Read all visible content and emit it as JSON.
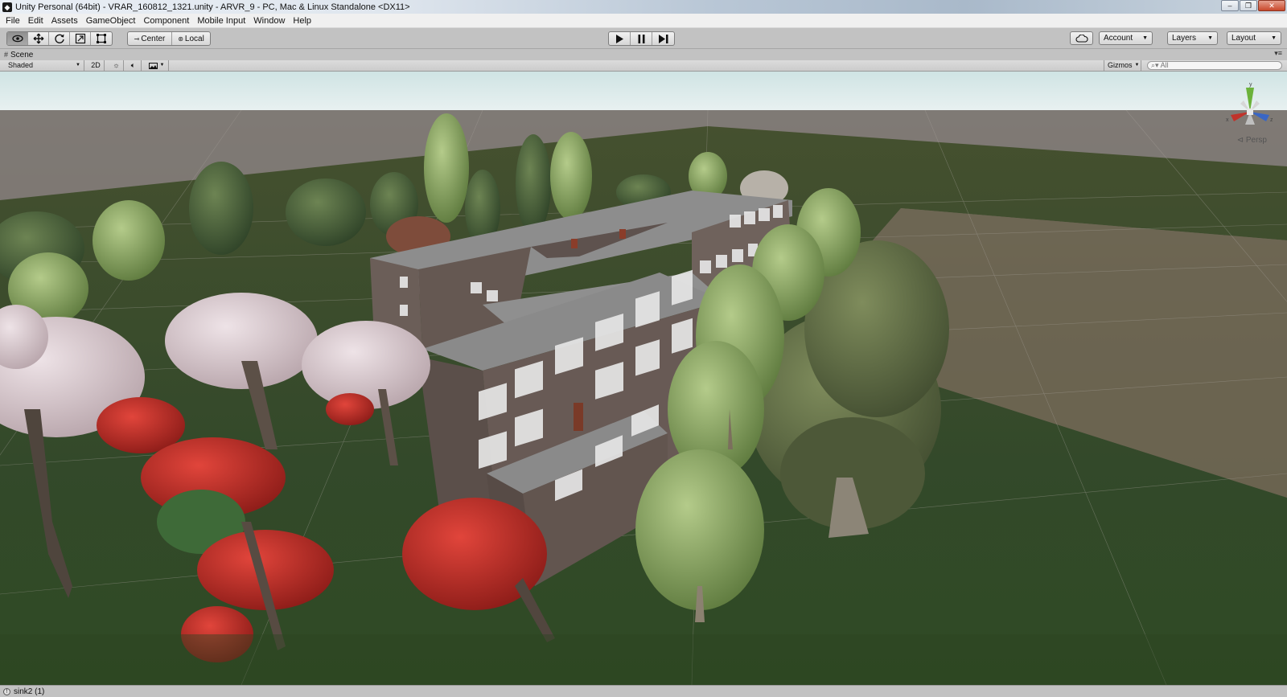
{
  "window": {
    "title": "Unity Personal (64bit) - VRAR_160812_1321.unity - ARVR_9 - PC, Mac & Linux Standalone <DX11>"
  },
  "menubar": {
    "items": [
      "File",
      "Edit",
      "Assets",
      "GameObject",
      "Component",
      "Mobile Input",
      "Window",
      "Help"
    ]
  },
  "toolbar": {
    "pivot_label": "Center",
    "space_label": "Local",
    "account_label": "Account",
    "layers_label": "Layers",
    "layout_label": "Layout"
  },
  "scene": {
    "tab_label": "Scene",
    "shading_mode": "Shaded",
    "mode_2d_label": "2D",
    "gizmos_label": "Gizmos",
    "search_placeholder": "All",
    "projection_label": "Persp"
  },
  "gizmo_axes": {
    "x": "x",
    "z": "z",
    "y": "y"
  },
  "status": {
    "message": "sink2 (1)"
  },
  "colors": {
    "sky": "#d9eaea",
    "ground_far": "#7e7772",
    "grass": "#3a4a2a",
    "building_wall": "#6a5c56",
    "building_roof": "#8c8c8c",
    "x_axis": "#c0332b",
    "y_axis": "#6bb23a",
    "z_axis": "#3a66c4"
  }
}
